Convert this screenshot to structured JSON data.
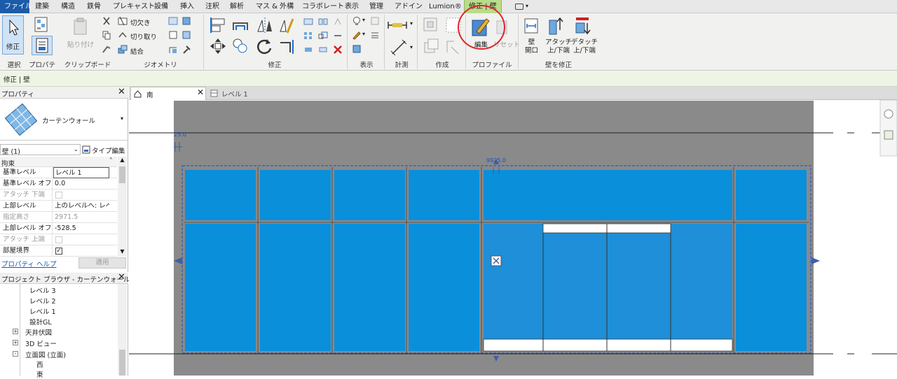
{
  "menu": {
    "tabs": [
      "ファイル",
      "建築",
      "構造",
      "鉄骨",
      "プレキャスト",
      "設備",
      "挿入",
      "注釈",
      "解析",
      "マス & 外構",
      "コラボレート",
      "表示",
      "管理",
      "アドイン",
      "Lumion®",
      "修正 | 壁"
    ]
  },
  "ribbon": {
    "modify_label": "修正",
    "paste_label": "貼り付け",
    "cut_label": "切欠き",
    "trim_label": "切り取り",
    "join_label": "結合",
    "edit_label": "編集",
    "reset_label": "リセット",
    "wall_open_label": "壁\n開口",
    "attach_label": "アタッチ\n上/下端",
    "detach_label": "デタッチ\n上/下端",
    "groups": [
      "選択",
      "プロパティ",
      "クリップボード",
      "ジオメトリ",
      "修正",
      "表示",
      "計測",
      "作成",
      "プロファイル",
      "壁を修正"
    ]
  },
  "context_bar": {
    "text": "修正 | 壁"
  },
  "properties": {
    "title": "プロパティ",
    "type_name": "カーテンウォール",
    "selector_value": "壁 (1)",
    "type_edit_label": "タイプ編集",
    "section": "拘束",
    "rows": [
      {
        "label": "基準レベル",
        "value": "レベル 1",
        "editable": true
      },
      {
        "label": "基準レベル オフ...",
        "value": "0.0",
        "editable": true
      },
      {
        "label": "アタッチ 下端",
        "value": "",
        "editable": false,
        "checkbox": true
      },
      {
        "label": "上部レベル",
        "value": "上のレベルへ: レベ...",
        "editable": true
      },
      {
        "label": "指定高さ",
        "value": "2971.5",
        "editable": false
      },
      {
        "label": "上部レベル オフ...",
        "value": "-528.5",
        "editable": true
      },
      {
        "label": "アタッチ 上端",
        "value": "",
        "editable": false,
        "checkbox": true
      },
      {
        "label": "部屋境界",
        "value": "",
        "editable": true,
        "checkbox": true,
        "checked": true
      }
    ],
    "help_link": "プロパティ ヘルプ",
    "apply_label": "適用"
  },
  "browser": {
    "title": "プロジェクト ブラウザ - カーテンウォール用...",
    "items": [
      {
        "text": "レベル 3",
        "indent": 3
      },
      {
        "text": "レベル 2",
        "indent": 3
      },
      {
        "text": "レベル 1",
        "indent": 3
      },
      {
        "text": "設計GL",
        "indent": 3
      },
      {
        "text": "天井伏図",
        "indent": 1,
        "toggle": "+"
      },
      {
        "text": "3D ビュー",
        "indent": 1,
        "toggle": "+"
      },
      {
        "text": "立面図 (立面)",
        "indent": 1,
        "toggle": "-"
      },
      {
        "text": "西",
        "indent": 3
      },
      {
        "text": "東",
        "indent": 3
      }
    ]
  },
  "view_tabs": [
    {
      "label": "南",
      "active": true
    },
    {
      "label": "レベル 1",
      "active": false
    }
  ],
  "dimensions": {
    "top_small": "25.0",
    "width": "9925.0"
  },
  "colors": {
    "accent": "#1c5ba8",
    "ctx_tab": "#b9dc8a",
    "panel": "#0891dd",
    "wall_grey": "#8a8a8a",
    "highlight_circle": "#d9262c"
  }
}
